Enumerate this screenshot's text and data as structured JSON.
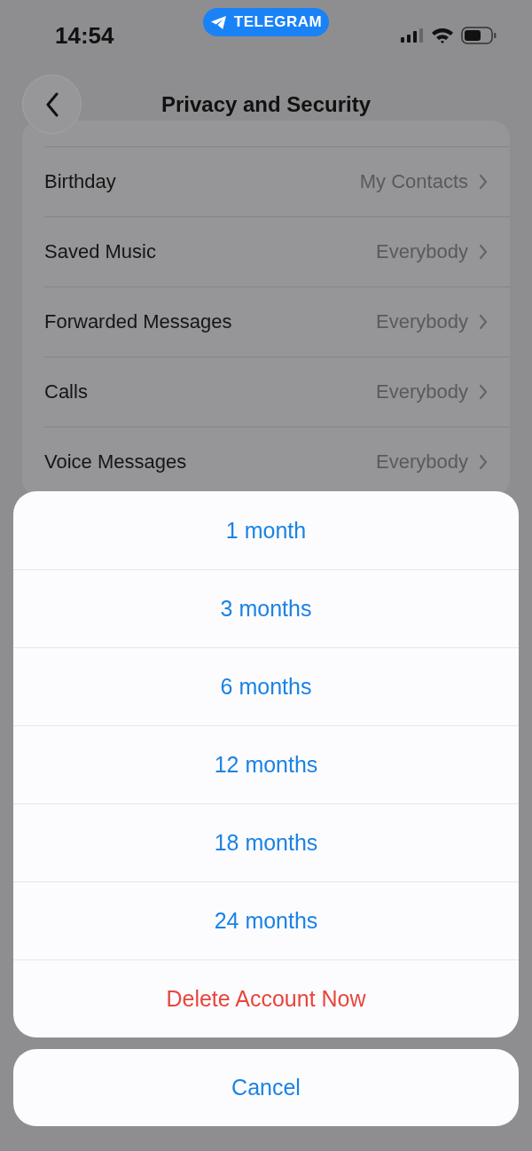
{
  "status_bar": {
    "time": "14:54",
    "app_pill": "TELEGRAM"
  },
  "nav": {
    "title": "Privacy and Security"
  },
  "settings": [
    {
      "label": "Birthday",
      "value": "My Contacts"
    },
    {
      "label": "Saved Music",
      "value": "Everybody"
    },
    {
      "label": "Forwarded Messages",
      "value": "Everybody"
    },
    {
      "label": "Calls",
      "value": "Everybody"
    },
    {
      "label": "Voice Messages",
      "value": "Everybody"
    }
  ],
  "action_sheet": {
    "options": [
      {
        "label": "1 month",
        "kind": "default"
      },
      {
        "label": "3 months",
        "kind": "default"
      },
      {
        "label": "6 months",
        "kind": "default"
      },
      {
        "label": "12 months",
        "kind": "default"
      },
      {
        "label": "18 months",
        "kind": "default"
      },
      {
        "label": "24 months",
        "kind": "default"
      },
      {
        "label": "Delete Account Now",
        "kind": "destructive"
      }
    ],
    "cancel": "Cancel"
  }
}
